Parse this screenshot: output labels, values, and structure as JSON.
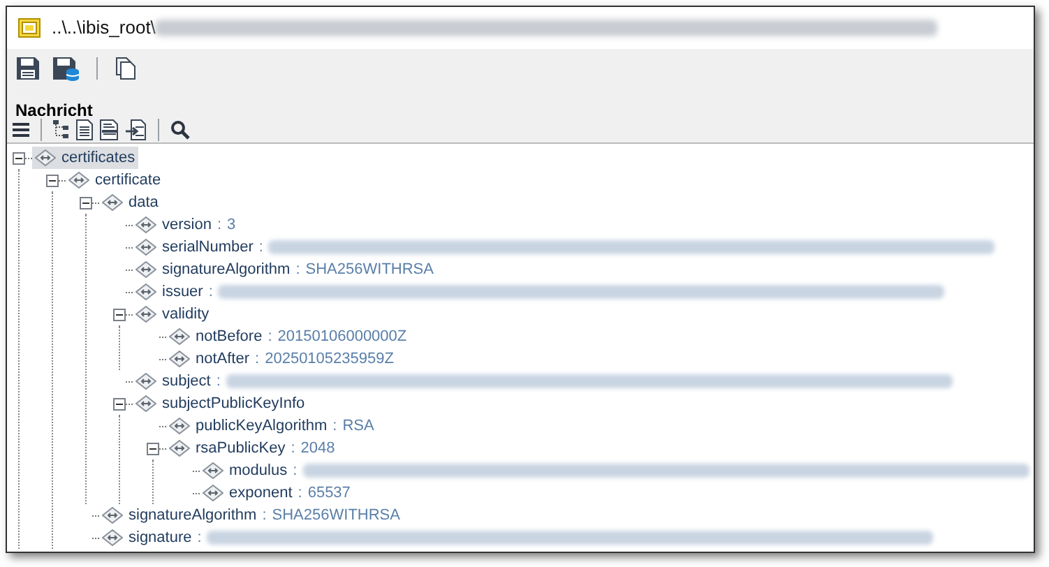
{
  "window": {
    "title": "..\\..\\ibis_root\\",
    "title_redacted": true
  },
  "toolbar": [
    {
      "kind": "save"
    },
    {
      "kind": "save-db"
    },
    {
      "kind": "separator"
    },
    {
      "kind": "copy"
    }
  ],
  "section_title": "Nachricht",
  "tree_toolbar": [
    {
      "kind": "menu"
    },
    {
      "kind": "separator"
    },
    {
      "kind": "tree"
    },
    {
      "kind": "document"
    },
    {
      "kind": "hex"
    },
    {
      "kind": "import"
    },
    {
      "kind": "separator"
    },
    {
      "kind": "search"
    }
  ],
  "tree": [
    {
      "name": "certificates",
      "selected": true,
      "expanded": true,
      "children": [
        {
          "name": "certificate",
          "selected": false,
          "expanded": true,
          "children": [
            {
              "name": "data",
              "selected": false,
              "expanded": true,
              "children": [
                {
                  "name": "version",
                  "sep": ":",
                  "value": "3",
                  "selected": false
                },
                {
                  "name": "serialNumber",
                  "sep": ":",
                  "redacted": true,
                  "selected": false
                },
                {
                  "name": "signatureAlgorithm",
                  "sep": ":",
                  "value": "SHA256WITHRSA",
                  "selected": false
                },
                {
                  "name": "issuer",
                  "sep": ":",
                  "redacted": true,
                  "selected": false
                },
                {
                  "name": "validity",
                  "selected": false,
                  "expanded": true,
                  "children": [
                    {
                      "name": "notBefore",
                      "sep": ":",
                      "value": "20150106000000Z",
                      "selected": false
                    },
                    {
                      "name": "notAfter",
                      "sep": ":",
                      "value": "20250105235959Z",
                      "selected": false
                    }
                  ]
                },
                {
                  "name": "subject",
                  "sep": ":",
                  "redacted": true,
                  "selected": false
                },
                {
                  "name": "subjectPublicKeyInfo",
                  "selected": false,
                  "expanded": true,
                  "children": [
                    {
                      "name": "publicKeyAlgorithm",
                      "sep": ":",
                      "value": "RSA",
                      "selected": false
                    },
                    {
                      "name": "rsaPublicKey",
                      "sep": ":",
                      "value": "2048",
                      "selected": false,
                      "expanded": true,
                      "children": [
                        {
                          "name": "modulus",
                          "sep": ":",
                          "redacted": true,
                          "selected": false
                        },
                        {
                          "name": "exponent",
                          "sep": ":",
                          "value": "65537",
                          "selected": false
                        }
                      ]
                    }
                  ]
                }
              ]
            },
            {
              "name": "signatureAlgorithm",
              "sep": ":",
              "value": "SHA256WITHRSA",
              "selected": false
            },
            {
              "name": "signature",
              "sep": ":",
              "redacted": true,
              "selected": false
            }
          ]
        }
      ]
    }
  ]
}
